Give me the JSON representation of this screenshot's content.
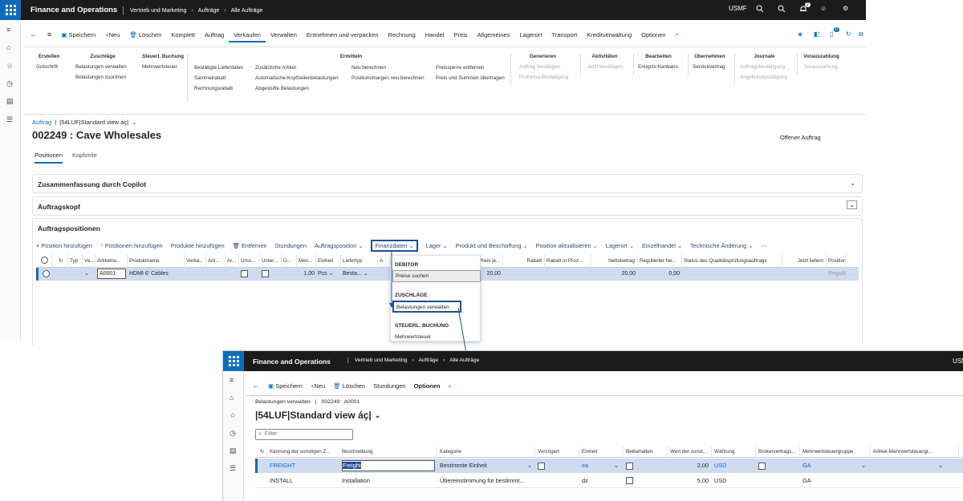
{
  "app": {
    "title": "Finance and Operations",
    "breadcrumbs": [
      "Vertrieb und Marketing",
      "Aufträge",
      "Alle Aufträge"
    ],
    "company": "USMF",
    "notif_count": "2"
  },
  "cmdbar": {
    "items": [
      "Speichern",
      "Neu",
      "Löschen",
      "Komplett",
      "Auftrag",
      "Verkaufen",
      "Verwalten",
      "Entnehmen und verpacken",
      "Rechnung",
      "Handel",
      "Preis",
      "Allgemeines",
      "Lagerort",
      "Transport",
      "Kreditverwaltung",
      "Optionen"
    ],
    "badge": "0"
  },
  "ribbon": {
    "erstellen": {
      "h": "Erstellen",
      "items": [
        "Gutschrift"
      ]
    },
    "zuschlaege": {
      "h": "Zuschläge",
      "items": [
        "Belastungen verwalten",
        "Belastungen zuordnen"
      ]
    },
    "steuer": {
      "h": "Steuerl. Buchung",
      "items": [
        "Mehrwertsteuer"
      ]
    },
    "ermitteln": {
      "h": "Ermitteln",
      "c1": [
        "Bestätigte Lieferdaten",
        "Sammelrabatt",
        "Rechnungsrabatt"
      ],
      "c2": [
        "Zusätzliche Artikel",
        "Automatische Kopfzeilenbelastungen",
        "Abgestufte Belastungen"
      ],
      "c3": [
        "Neu berechnen",
        "Positionsmargen neu berechnen"
      ],
      "c4": [
        "Preissperre entfernen",
        "Preis und Summen übertragen"
      ]
    },
    "generieren": {
      "h": "Generieren",
      "items": [
        "Auftrag bestätigen",
        "Proforma-Bestätigung"
      ]
    },
    "aktivitaeten": {
      "h": "Aktivitäten",
      "items": [
        "Jetzt bestätigen"
      ]
    },
    "bearbeiten": {
      "h": "Bearbeiten",
      "items": [
        "Ereignis-Kanbans"
      ]
    },
    "uebernehmen": {
      "h": "Übernehmen",
      "items": [
        "Servicevertrag"
      ]
    },
    "journale": {
      "h": "Journale",
      "items": [
        "Auftragsbestätigung",
        "Angebotsbestätigung"
      ]
    },
    "vorauszahlung": {
      "h": "Vorauszahlung",
      "items": [
        "Vorauszahlung"
      ]
    }
  },
  "form": {
    "crumb_link": "Auftrag",
    "view": "|54LUF|Standard view áç|",
    "title": "002249 : Cave Wholesales",
    "status": "Offener Auftrag",
    "tabs": [
      "Positionen",
      "Kopfzeile"
    ]
  },
  "sections": {
    "copilot": "Zusammenfassung durch Copilot",
    "kopf": "Auftragskopf",
    "pos": "Auftragspositionen"
  },
  "gridtb": [
    "Position hinzufügen",
    "Positionen hinzufügen",
    "Produkte hinzufügen",
    "Entfernen",
    "Stundungen",
    "Auftragsposition",
    "Finanzdaten",
    "Lager",
    "Produkt und Beschaffung",
    "Position aktualisieren",
    "Lagerort",
    "Einzelhandel",
    "Technische Änderung"
  ],
  "grid": {
    "headers": [
      "Typ",
      "Va...",
      "Artikelnu...",
      "Produktname",
      "Verka...",
      "Arti...",
      "Ar...",
      "Ums...",
      "Unter...",
      "Ü...",
      "Men...",
      "Einheit",
      "Liefertyp",
      "A",
      "Preis je...",
      "Rabatt",
      "Rabatt in Proz...",
      "Nettobetrag",
      "Regulierter Ne...",
      "Status des Qualitätsprüfungsauftrags",
      "Jetzt liefern",
      "Position"
    ],
    "row": {
      "artikel": "A0001",
      "produkt": "HDMI 6' Cables",
      "menge": "1,00",
      "einheit": "Pcs",
      "liefertyp": "Besta...",
      "preis": "20,00",
      "netto": "20,00",
      "reguliert": "0,00",
      "position": "Regulär"
    }
  },
  "dropdown": {
    "h1": "DEBITOR",
    "i1": "Preise suchen",
    "h2": "ZUSCHLÄGE",
    "i2": "Belastungen verwalten",
    "h3": "STEUERL. BUCHUNG",
    "i3": "Mehrwertsteuer"
  },
  "w2": {
    "title": "Finance and Operations",
    "crumbs": [
      "Vertrieb und Marketing",
      "Aufträge",
      "Alle Aufträge"
    ],
    "company": "USM",
    "cmd": [
      "Speichern",
      "Neu",
      "Löschen",
      "Stundungen",
      "Optionen"
    ],
    "caption": "Belastungen verwalten",
    "record": "002249 : A0001",
    "view": "|54LUF|Standard view áç|",
    "filter": "Filter",
    "headers": [
      "Kennung der sonstigen Z...",
      "Beschreibung",
      "Kategorie",
      "Verzögert",
      "Einheit",
      "Beibehalten",
      "Wert der sonst...",
      "Währung",
      "Brokervertrags...",
      "Mehrwertsteuergruppe",
      "Artikel-Mehrwertsteuergr..."
    ],
    "rows": [
      {
        "code": "FREIGHT",
        "desc": "Freight",
        "cat": "Bestimmte Einheit",
        "unit": "ea",
        "val": "2,00",
        "cur": "USD",
        "tax": "GA"
      },
      {
        "code": "INSTALL",
        "desc": "Installation",
        "cat": "Übereinstimmung für bestimmt...",
        "unit": "dz",
        "val": "5,00",
        "cur": "USD",
        "tax": "GA"
      }
    ]
  }
}
